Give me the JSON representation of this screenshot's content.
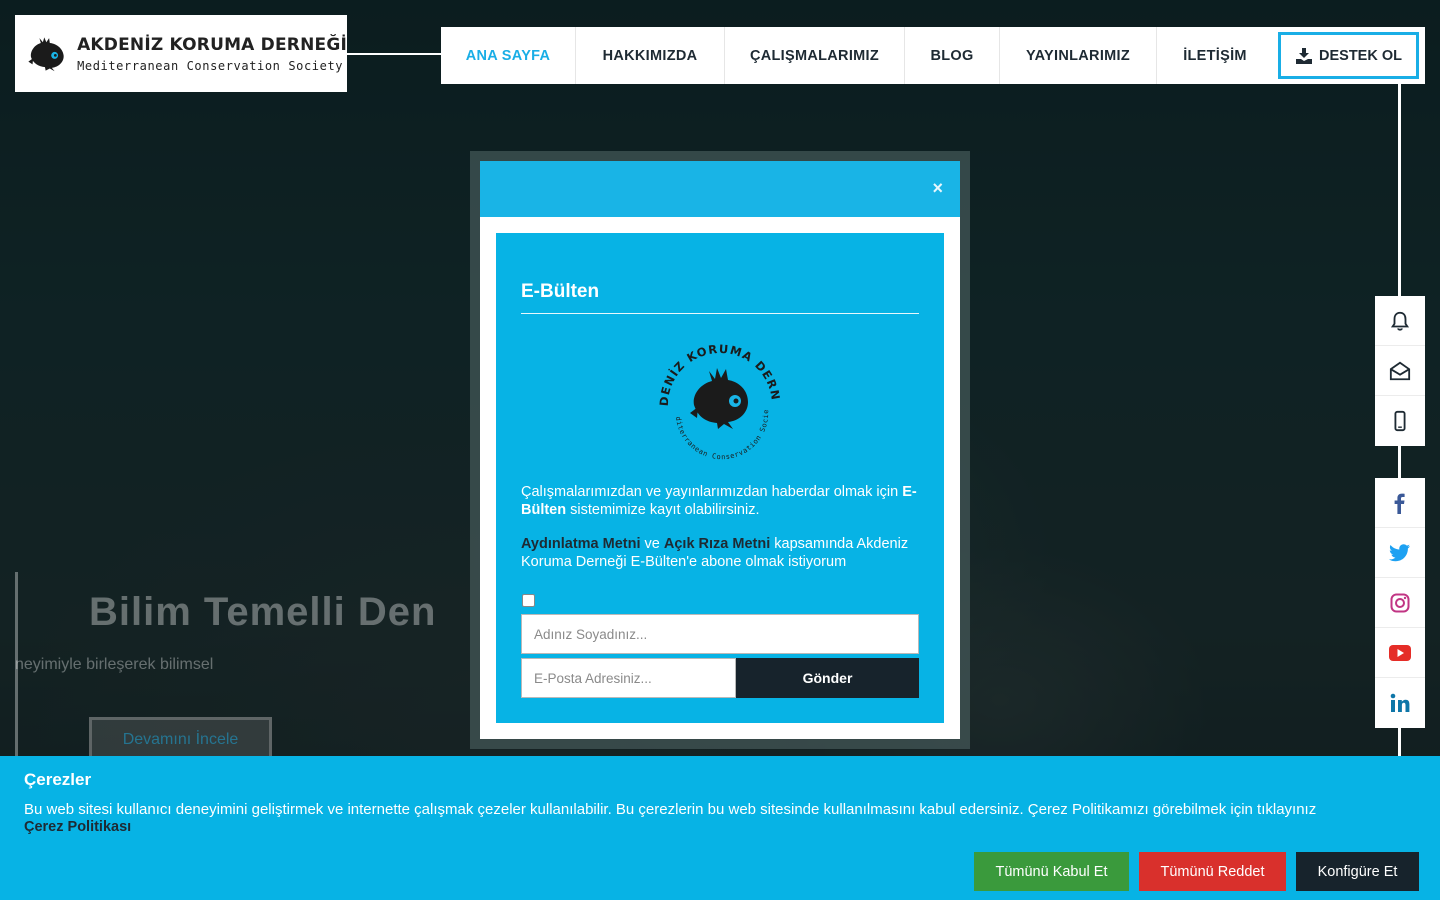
{
  "brand": {
    "name": "AKDENİZ KORUMA DERNEĞİ",
    "subtitle": "Mediterranean Conservation Society"
  },
  "nav": {
    "items": [
      {
        "label": "ANA SAYFA",
        "active": true
      },
      {
        "label": "HAKKIMIZDA"
      },
      {
        "label": "ÇALIŞMALARIMIZ"
      },
      {
        "label": "BLOG"
      },
      {
        "label": "YAYINLARIMIZ"
      },
      {
        "label": "İLETİŞİM"
      }
    ],
    "support_label": "DESTEK OL",
    "support_icon": "hand-donate-icon"
  },
  "side_contact": [
    "bell-icon",
    "envelope-open-icon",
    "mobile-phone-icon"
  ],
  "side_social": [
    "facebook-icon",
    "twitter-icon",
    "instagram-icon",
    "youtube-icon",
    "linkedin-icon"
  ],
  "hero": {
    "title": "Bilim Temelli Den",
    "subtitle": "neyimiyle birleşerek bilimsel",
    "button_label": "Devamını İncele"
  },
  "modal": {
    "close_label": "×",
    "title": "E-Bülten",
    "badge_top_text": "AKDENİZ KORUMA DERNEĞİ",
    "badge_bottom_text": "Mediterranean Conservation Society",
    "intro_before": "Çalışmalarımızdan ve yayınlarımızdan haberdar olmak için ",
    "intro_bold": "E-Bülten",
    "intro_after": " sistemimize kayıt olabilirsiniz.",
    "consent_link1": "Aydınlatma Metni",
    "consent_and": " ve ",
    "consent_link2": "Açık Rıza Metni",
    "consent_rest": " kapsamında Akdeniz Koruma Derneği E-Bülten'e abone olmak istiyorum",
    "consent_checked": false,
    "name_placeholder": "Adınız Soyadınız...",
    "email_placeholder": "E-Posta Adresiniz...",
    "submit_label": "Gönder"
  },
  "cookie": {
    "title": "Çerezler",
    "text": "Bu web sitesi kullanıcı deneyimini geliştirmek ve internette çalışmak çezeler kullanılabilir. Bu çerezlerin bu web sitesinde kullanılmasını kabul edersiniz. Çerez Politikamızı görebilmek için tıklayınız",
    "policy_link": "Çerez Politikası",
    "accept_label": "Tümünü Kabul Et",
    "reject_label": "Tümünü Reddet",
    "configure_label": "Konfigüre Et"
  },
  "colors": {
    "accent": "#19aee6",
    "cookie_bg": "#07b3e5",
    "dark": "#17232c",
    "accept": "#3a9a3c",
    "reject": "#d9302c"
  }
}
